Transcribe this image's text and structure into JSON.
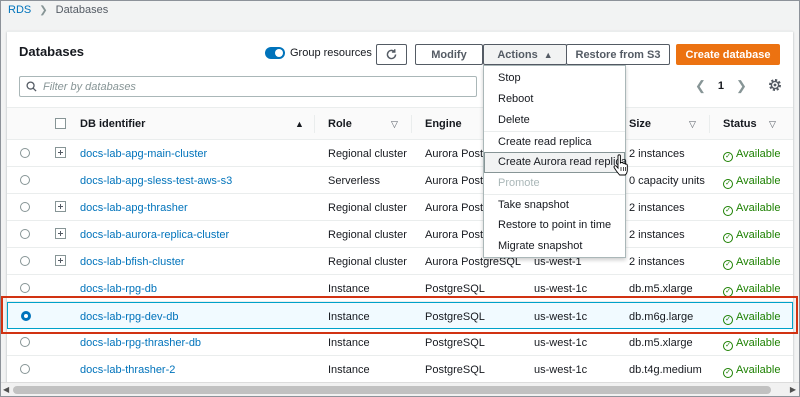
{
  "breadcrumb": {
    "root": "RDS",
    "current": "Databases"
  },
  "header": {
    "title": "Databases",
    "group_resources_label": "Group resources",
    "modify_label": "Modify",
    "actions_label": "Actions",
    "restore_label": "Restore from S3",
    "create_label": "Create database"
  },
  "search": {
    "placeholder": "Filter by databases"
  },
  "pagination": {
    "page": "1"
  },
  "columns": {
    "db_identifier": "DB identifier",
    "role": "Role",
    "engine": "Engine",
    "size": "Size",
    "status": "Status"
  },
  "rows": [
    {
      "id": "docs-lab-apg-main-cluster",
      "role": "Regional cluster",
      "engine": "Aurora Postgre",
      "region": "",
      "size": "2 instances",
      "status": "Available"
    },
    {
      "id": "docs-lab-apg-sless-test-aws-s3",
      "role": "Serverless",
      "engine": "Aurora Postgre",
      "region": "",
      "size": "0 capacity units",
      "status": "Available"
    },
    {
      "id": "docs-lab-apg-thrasher",
      "role": "Regional cluster",
      "engine": "Aurora Postgre",
      "region": "",
      "size": "2 instances",
      "status": "Available"
    },
    {
      "id": "docs-lab-aurora-replica-cluster",
      "role": "Regional cluster",
      "engine": "Aurora Postgre",
      "region": "",
      "size": "2 instances",
      "status": "Available"
    },
    {
      "id": "docs-lab-bfish-cluster",
      "role": "Regional cluster",
      "engine": "Aurora PostgreSQL",
      "region": "us-west-1",
      "size": "2 instances",
      "status": "Available"
    },
    {
      "id": "docs-lab-rpg-db",
      "role": "Instance",
      "engine": "PostgreSQL",
      "region": "us-west-1c",
      "size": "db.m5.xlarge",
      "status": "Available"
    },
    {
      "id": "docs-lab-rpg-dev-db",
      "role": "Instance",
      "engine": "PostgreSQL",
      "region": "us-west-1c",
      "size": "db.m6g.large",
      "status": "Available"
    },
    {
      "id": "docs-lab-rpg-thrasher-db",
      "role": "Instance",
      "engine": "PostgreSQL",
      "region": "us-west-1c",
      "size": "db.m5.xlarge",
      "status": "Available"
    },
    {
      "id": "docs-lab-thrasher-2",
      "role": "Instance",
      "engine": "PostgreSQL",
      "region": "us-west-1c",
      "size": "db.t4g.medium",
      "status": "Available"
    }
  ],
  "actions_menu": [
    "Stop",
    "Reboot",
    "Delete",
    "Create read replica",
    "Create Aurora read replica",
    "Promote",
    "Take snapshot",
    "Restore to point in time",
    "Migrate snapshot"
  ],
  "colors": {
    "accent": "#0073bb",
    "primary_button": "#ec7211",
    "status_ok": "#1d8102",
    "highlight": "#d13212"
  }
}
